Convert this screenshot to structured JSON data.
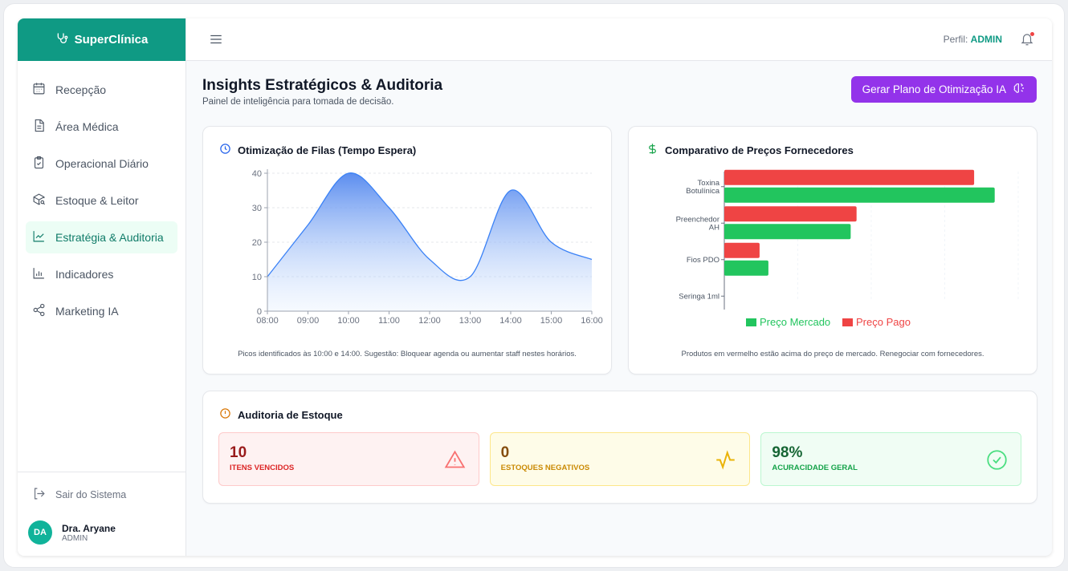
{
  "brand": {
    "name": "SuperClínica"
  },
  "sidebar": {
    "items": [
      {
        "label": "Recepção",
        "icon": "calendar-icon"
      },
      {
        "label": "Área Médica",
        "icon": "file-text-icon"
      },
      {
        "label": "Operacional Diário",
        "icon": "clipboard-check-icon"
      },
      {
        "label": "Estoque & Leitor",
        "icon": "package-search-icon"
      },
      {
        "label": "Estratégia & Auditoria",
        "icon": "line-chart-icon",
        "active": true
      },
      {
        "label": "Indicadores",
        "icon": "bar-chart-icon"
      },
      {
        "label": "Marketing IA",
        "icon": "share-icon"
      }
    ],
    "logout_label": "Sair do Sistema",
    "user": {
      "initials": "DA",
      "name": "Dra. Aryane",
      "role": "ADMIN"
    }
  },
  "header": {
    "profile_prefix": "Perfil:",
    "profile_role": "ADMIN"
  },
  "page": {
    "title": "Insights Estratégicos & Auditoria",
    "subtitle": "Painel de inteligência para tomada de decisão.",
    "ai_button_label": "Gerar Plano de Otimização IA"
  },
  "queue_card": {
    "title": "Otimização de Filas (Tempo Espera)",
    "note": "Picos identificados às 10:00 e 14:00. Sugestão: Bloquear agenda ou aumentar staff nestes horários."
  },
  "price_card": {
    "title": "Comparativo de Preços Fornecedores",
    "note": "Produtos em vermelho estão acima do preço de mercado. Renegociar com fornecedores."
  },
  "audit_card": {
    "title": "Auditoria de Estoque",
    "boxes": [
      {
        "value": "10",
        "label": "ITENS VENCIDOS",
        "icon": "alert-triangle-icon"
      },
      {
        "value": "0",
        "label": "ESTOQUES NEGATIVOS",
        "icon": "activity-icon"
      },
      {
        "value": "98%",
        "label": "ACURACIDADE GERAL",
        "icon": "check-circle-icon"
      }
    ]
  },
  "colors": {
    "brand": "#0f9a84",
    "purple": "#9333ea",
    "area_line": "#3b82f6",
    "market": "#22c55e",
    "paid": "#ef4444"
  },
  "chart_data": [
    {
      "type": "area",
      "title": "Otimização de Filas (Tempo Espera)",
      "x": [
        "08:00",
        "09:00",
        "10:00",
        "11:00",
        "12:00",
        "13:00",
        "14:00",
        "15:00",
        "16:00"
      ],
      "values": [
        10,
        25,
        40,
        30,
        15,
        10,
        35,
        20,
        15
      ],
      "ylim": [
        0,
        40
      ],
      "yticks": [
        0,
        10,
        20,
        30,
        40
      ],
      "xlabel": "",
      "ylabel": ""
    },
    {
      "type": "bar",
      "orientation": "horizontal",
      "title": "Comparativo de Preços Fornecedores",
      "categories": [
        [
          "Toxina",
          "Botulínica"
        ],
        [
          "Preenchedor",
          "AH"
        ],
        [
          "Fios PDO"
        ],
        [
          "Seringa 1ml"
        ]
      ],
      "series": [
        {
          "name": "Preço Pago",
          "values": [
            850,
            450,
            120,
            0
          ]
        },
        {
          "name": "Preço Mercado",
          "values": [
            920,
            430,
            150,
            0
          ]
        }
      ],
      "xlim": [
        0,
        1000
      ],
      "legend": "bottom"
    }
  ]
}
